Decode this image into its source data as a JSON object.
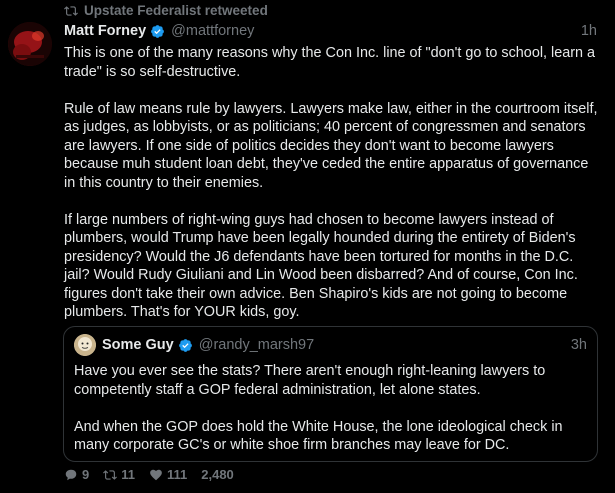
{
  "retweet": {
    "label": "Upstate Federalist retweeted",
    "icon": "retweet-icon"
  },
  "tweet": {
    "author_name": "Matt Forney",
    "handle": "@mattforney",
    "time": "1h",
    "verified": true,
    "paragraphs": [
      "This is one of the many reasons why the Con Inc. line of \"don't go to school, learn a trade\" is so self-destructive.",
      "Rule of law means rule by lawyers. Lawyers make law, either in the courtroom itself, as judges, as lobbyists, or as politicians; 40 percent of congressmen and senators are lawyers. If one side of politics decides they don't want to become lawyers because muh student loan debt, they've ceded the entire apparatus of governance in this country to their enemies.",
      "If large numbers of right-wing guys had chosen to become lawyers instead of plumbers, would Trump have been legally hounded during the entirety of Biden's presidency? Would the J6 defendants have been tortured for months in the D.C. jail? Would Rudy Giuliani and Lin Wood been disbarred? And of course, Con Inc. figures don't take their own advice. Ben Shapiro's kids are not going to become plumbers. That's for YOUR kids, goy."
    ]
  },
  "quote": {
    "author_name": "Some Guy",
    "handle": "@randy_marsh97",
    "time": "3h",
    "verified": true,
    "paragraphs": [
      "Have you ever see the stats? There aren't enough right-leaning lawyers to competently staff a GOP federal administration, let alone states.",
      "And when the GOP does hold the White House, the lone ideological check in many corporate GC's or white shoe firm branches may leave for DC."
    ]
  },
  "actions": {
    "replies": "9",
    "retweets": "11",
    "likes": "111",
    "views": "2,480"
  },
  "colors": {
    "background": "#000000",
    "text": "#e7e9ea",
    "muted": "#71767b",
    "verified": "#1d9bf0",
    "border": "#2f3336"
  }
}
